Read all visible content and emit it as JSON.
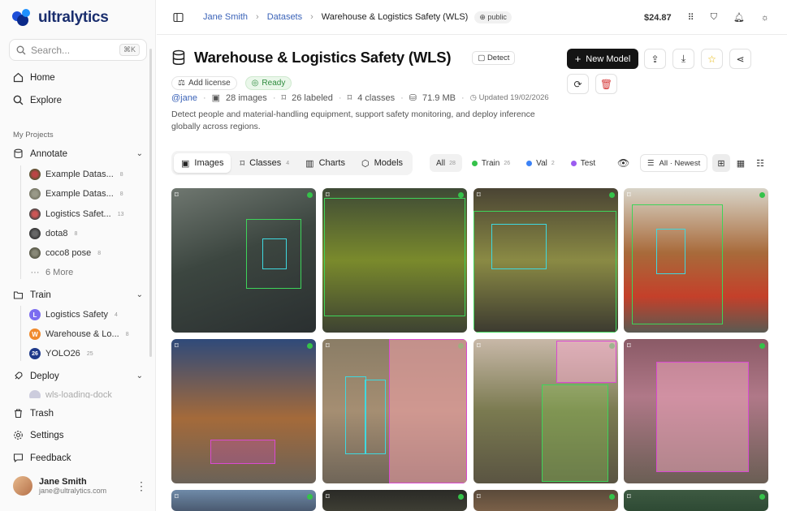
{
  "brand": {
    "name": "ultralytics"
  },
  "search": {
    "placeholder": "Search...",
    "shortcut": "⌘K"
  },
  "nav": {
    "home": "Home",
    "explore": "Explore",
    "section": "My Projects",
    "annotate": "Annotate",
    "annotate_items": [
      {
        "label": "Example Datas...",
        "count": "8"
      },
      {
        "label": "Example Datas...",
        "count": "8"
      },
      {
        "label": "Logistics Safet...",
        "count": "13"
      },
      {
        "label": "dota8",
        "count": "8"
      },
      {
        "label": "coco8 pose",
        "count": "8"
      },
      {
        "label": "6 More",
        "count": ""
      }
    ],
    "train": "Train",
    "train_items": [
      {
        "badge": "L",
        "label": "Logistics Safety",
        "count": "4",
        "color": "#7b6cf0"
      },
      {
        "badge": "W",
        "label": "Warehouse & Lo...",
        "count": "8",
        "color": "#f08a2c"
      },
      {
        "badge": "26",
        "label": "YOLO26",
        "count": "25",
        "color": "#1f3a8a"
      }
    ],
    "deploy": "Deploy",
    "deploy_item": "wls-loading-dock",
    "trash": "Trash",
    "settings": "Settings",
    "feedback": "Feedback"
  },
  "user": {
    "name": "Jane Smith",
    "email": "jane@ultralytics.com"
  },
  "breadcrumb": {
    "user": "Jane Smith",
    "section": "Datasets",
    "current": "Warehouse & Logistics Safety (WLS)",
    "visibility": "public"
  },
  "topbar": {
    "credit": "$24.87"
  },
  "dataset": {
    "title": "Warehouse & Logistics Safety (WLS)",
    "task": "Detect",
    "license": "Add license",
    "status": "Ready",
    "handle": "@jane",
    "images": "28 images",
    "labeled": "26 labeled",
    "classes": "4 classes",
    "size": "71.9 MB",
    "updated": "Updated 19/02/2026",
    "description": "Detect people and material-handling equipment, support safety monitoring, and deploy inference globally across regions."
  },
  "actions": {
    "new_model": "New Model"
  },
  "tabs": [
    {
      "label": "Images",
      "count": ""
    },
    {
      "label": "Classes",
      "count": "4"
    },
    {
      "label": "Charts",
      "count": ""
    },
    {
      "label": "Models",
      "count": ""
    }
  ],
  "filters": {
    "all": {
      "label": "All",
      "count": "28"
    },
    "train": {
      "label": "Train",
      "count": "26",
      "color": "#35c24a"
    },
    "val": {
      "label": "Val",
      "count": "2",
      "color": "#3b82f6"
    },
    "test": {
      "label": "Test",
      "color": "#9b5cf0"
    }
  },
  "sort": {
    "label": "All · Newest"
  },
  "colors": {
    "accent": "#3b63b8",
    "ready": "#2e8b3e",
    "train": "#35c24a"
  }
}
